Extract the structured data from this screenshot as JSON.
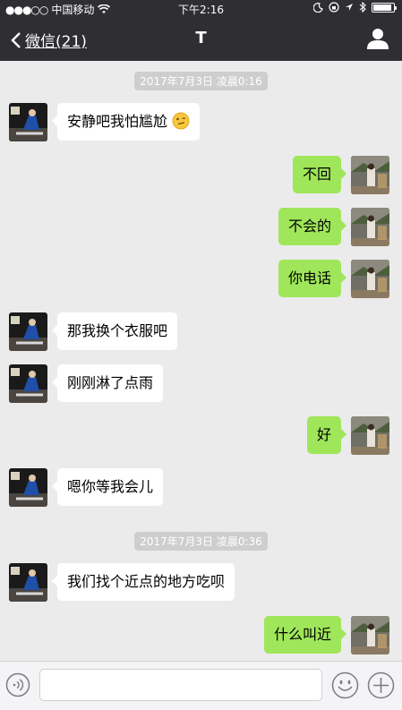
{
  "status_bar": {
    "signal": "●●●○○",
    "carrier": "中国移动",
    "time": "下午2:16"
  },
  "nav": {
    "back_label": "微信(21)",
    "title": "T"
  },
  "timestamps": [
    "2017年7月3日 凌晨0:16",
    "2017年7月3日 凌晨0:36"
  ],
  "messages": [
    {
      "side": "in",
      "text": "安静吧我怕尴尬",
      "emoji": "smirk-emoji"
    },
    {
      "side": "out",
      "text": "不回"
    },
    {
      "side": "out",
      "text": "不会的"
    },
    {
      "side": "out",
      "text": "你电话"
    },
    {
      "side": "in",
      "text": "那我换个衣服吧"
    },
    {
      "side": "in",
      "text": "刚刚淋了点雨"
    },
    {
      "side": "out",
      "text": "好"
    },
    {
      "side": "in",
      "text": "嗯你等我会儿"
    },
    {
      "side": "in",
      "text": "我们找个近点的地方吃呗"
    },
    {
      "side": "out",
      "text": "什么叫近"
    }
  ],
  "input_bar": {
    "icons": [
      "voice-icon",
      "emoji-icon",
      "plus-icon"
    ]
  },
  "colors": {
    "header_bg": "#2f2f33",
    "chat_bg": "#ebebeb",
    "outgoing_bubble": "#9fe65a",
    "incoming_bubble": "#ffffff"
  }
}
